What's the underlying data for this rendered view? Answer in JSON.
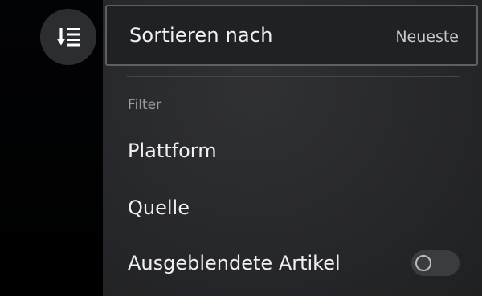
{
  "sort": {
    "label": "Sortieren nach",
    "value": "Neueste",
    "icon": "sort-descending-icon"
  },
  "filter": {
    "heading": "Filter",
    "items": [
      {
        "label": "Plattform"
      },
      {
        "label": "Quelle"
      },
      {
        "label": "Ausgeblendete Artikel",
        "toggle_on": false
      }
    ]
  },
  "colors": {
    "panel_bg": "#26272a",
    "left_rail_bg": "#000000",
    "fab_bg": "#2b2d30",
    "selected_border": "#5f6063",
    "text_primary": "#f0f0f0",
    "text_secondary": "#9b9c9f"
  }
}
